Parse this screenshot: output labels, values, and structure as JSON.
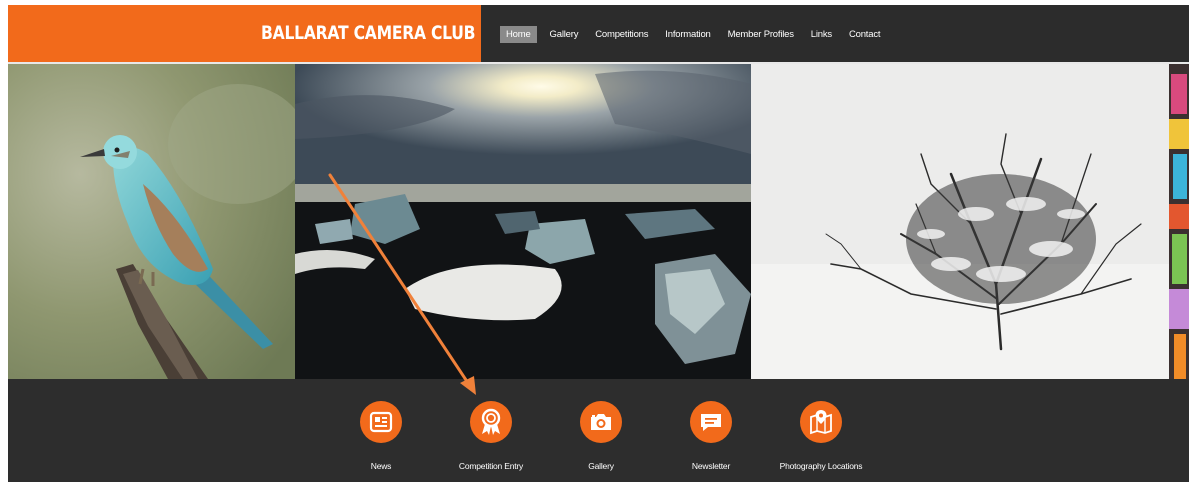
{
  "brand": {
    "title": "BALLARAT CAMERA CLUB"
  },
  "nav": {
    "items": [
      {
        "label": "Home",
        "active": true
      },
      {
        "label": "Gallery"
      },
      {
        "label": "Competitions"
      },
      {
        "label": "Information"
      },
      {
        "label": "Member Profiles"
      },
      {
        "label": "Links"
      },
      {
        "label": "Contact"
      }
    ]
  },
  "hero": {
    "images": [
      {
        "subject": "bird-on-branch"
      },
      {
        "subject": "ice-beach-sunset"
      },
      {
        "subject": "snowy-bush"
      },
      {
        "subject": "graffiti-wall"
      }
    ]
  },
  "quick_links": [
    {
      "label": "News",
      "icon": "news-icon"
    },
    {
      "label": "Competition Entry",
      "icon": "award-ribbon-icon"
    },
    {
      "label": "Gallery",
      "icon": "camera-icon"
    },
    {
      "label": "Newsletter",
      "icon": "chat-bubble-icon"
    },
    {
      "label": "Photography Locations",
      "icon": "map-pin-icon"
    }
  ],
  "colors": {
    "brand": "#f26a1b",
    "dark": "#2c2c2c",
    "annotation": "#f0813a"
  }
}
